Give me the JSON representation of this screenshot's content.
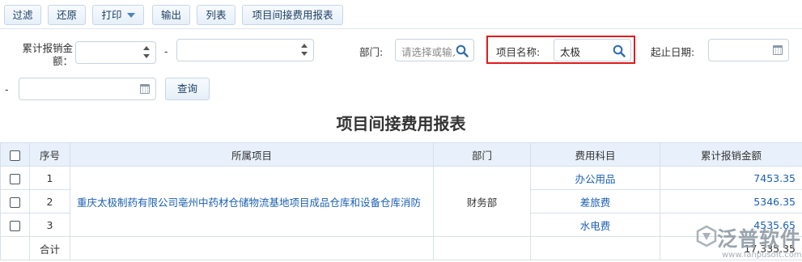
{
  "toolbar": {
    "filter": "过滤",
    "reset": "还原",
    "print": "打印",
    "export": "输出",
    "list": "列表",
    "report": "项目间接费用报表"
  },
  "filters": {
    "amount_label": "累计报销金额：",
    "range_sep": "-",
    "dept_label": "部门:",
    "dept_placeholder": "请选择或输入",
    "project_label": "项目名称:",
    "project_value": "太极",
    "date_label": "起止日期:",
    "date_sep": "-",
    "query": "查询"
  },
  "report": {
    "title": "项目间接费用报表",
    "columns": [
      "序号",
      "所属项目",
      "部门",
      "费用科目",
      "累计报销金额"
    ],
    "project": "重庆太极制药有限公司亳州中药材仓储物流基地项目成品仓库和设备仓库消防",
    "department": "财务部",
    "rows": [
      {
        "no": "1",
        "subject": "办公用品",
        "amount": "7453.35"
      },
      {
        "no": "2",
        "subject": "差旅费",
        "amount": "5346.35"
      },
      {
        "no": "3",
        "subject": "水电费",
        "amount": "4535.65"
      }
    ],
    "total_label": "合计",
    "total_amount": "17,335.35"
  },
  "watermark": {
    "brand": "泛普软件",
    "url": "www.fanpusoft.com"
  },
  "icons": {
    "search": "search-icon",
    "calendar": "calendar-icon",
    "spinner": "spinner-icon",
    "dropdown": "caret-down-icon"
  },
  "colors": {
    "accent": "#1a5fb4",
    "highlight": "#e01b1b",
    "header_bg": "#e8f1fb"
  }
}
